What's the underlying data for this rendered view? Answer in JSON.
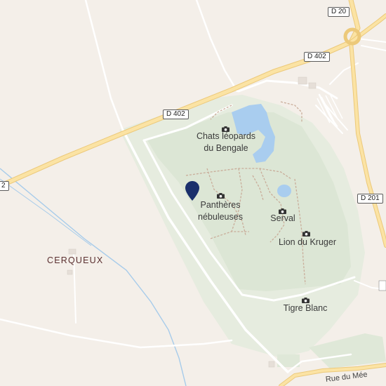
{
  "map": {
    "place_label": "CERQUEUX",
    "road_shields": {
      "d20": "D 20",
      "d402_east": "D 402",
      "d402_center": "D 402",
      "d402_edge": "2",
      "d201": "D 201"
    },
    "street_label": "Rue du Mée",
    "points_of_interest": [
      {
        "name_line1": "Chats léopards",
        "name_line2": "du Bengale",
        "icon": "camera-icon"
      },
      {
        "name_line1": "Panthères",
        "name_line2": "nébuleuses",
        "icon": "camera-icon"
      },
      {
        "name_line1": "Serval",
        "icon": "camera-icon"
      },
      {
        "name_line1": "Lion du Kruger",
        "icon": "camera-icon"
      },
      {
        "name_line1": "Tigre Blanc",
        "icon": "camera-icon"
      }
    ],
    "marker": {
      "icon": "location-pin-icon",
      "color": "#1a2f6b"
    },
    "colors": {
      "land": "#f4efe9",
      "park": "#e5ebdf",
      "park_inner": "#dfe8d8",
      "water": "#a9cdef",
      "major_road": "#fbe3a4",
      "major_road_edge": "#ecc97a",
      "minor_road": "#ffffff",
      "stream": "#9fc6e8"
    }
  }
}
